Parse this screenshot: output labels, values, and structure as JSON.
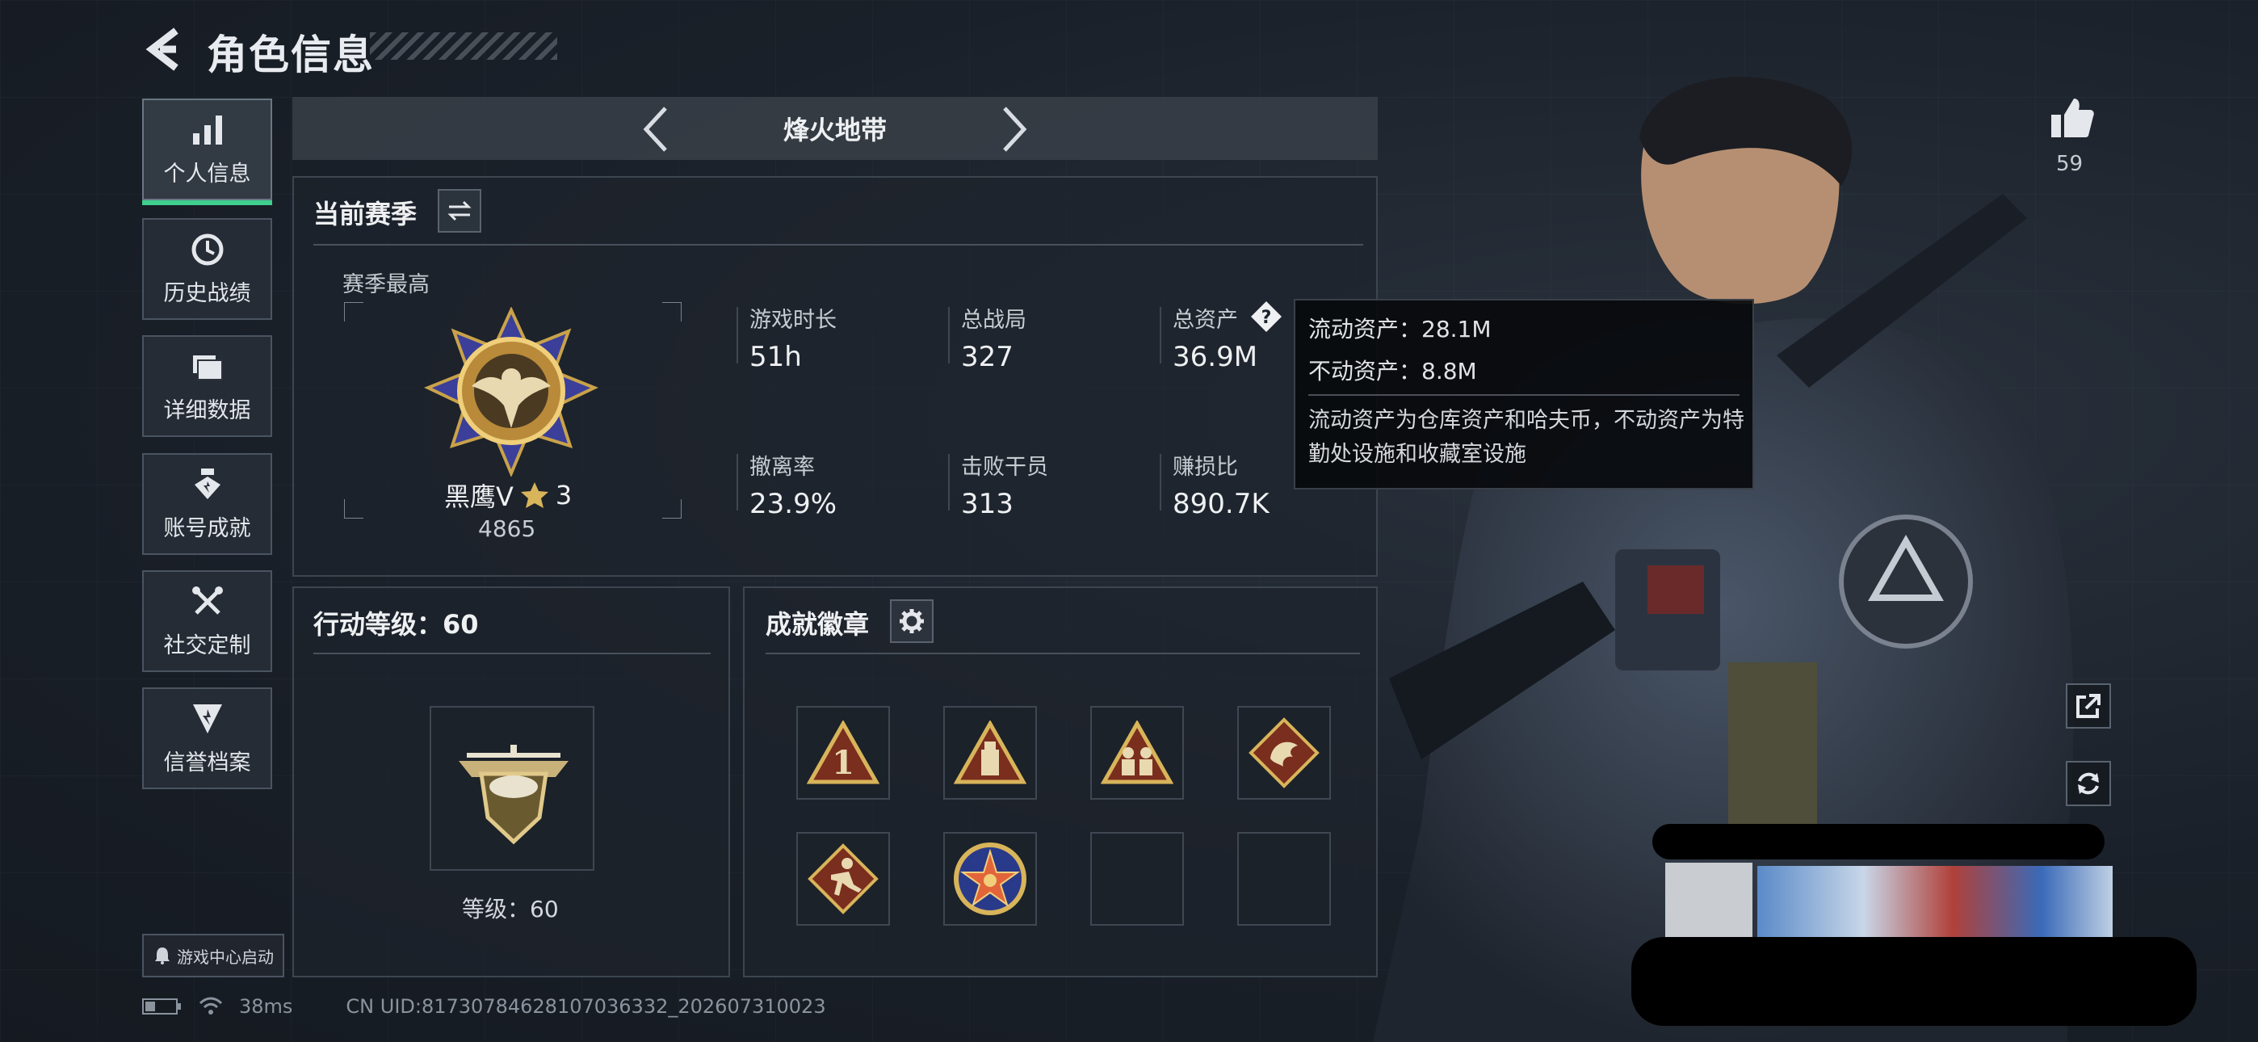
{
  "header": {
    "title": "角色信息"
  },
  "sidebar": {
    "items": [
      {
        "label": "个人信息",
        "icon": "bar-chart-icon",
        "active": true
      },
      {
        "label": "历史战绩",
        "icon": "history-clock-icon",
        "active": false
      },
      {
        "label": "详细数据",
        "icon": "folder-icon",
        "active": false
      },
      {
        "label": "账号成就",
        "icon": "medal-icon",
        "active": false
      },
      {
        "label": "社交定制",
        "icon": "tools-icon",
        "active": false
      },
      {
        "label": "信誉档案",
        "icon": "shield-icon",
        "active": false
      }
    ],
    "launch_label": "游戏中心启动"
  },
  "mode_nav": {
    "label": "烽火地带"
  },
  "season": {
    "title": "当前赛季",
    "best_label": "赛季最高",
    "rank_name": "黑鹰Ⅴ",
    "rank_stars": "3",
    "rank_points": "4865",
    "stats": [
      {
        "label": "游戏时长",
        "value": "51h"
      },
      {
        "label": "总战局",
        "value": "327"
      },
      {
        "label": "总资产",
        "value": "36.9M"
      },
      {
        "label": "撤离率",
        "value": "23.9%"
      },
      {
        "label": "击败干员",
        "value": "313"
      },
      {
        "label": "赚损比",
        "value": "890.7K"
      }
    ]
  },
  "tooltip": {
    "liquid": "流动资产：28.1M",
    "fixed": "不动资产：8.8M",
    "desc": "流动资产为仓库资产和哈夫币，不动资产为特勤处设施和收藏室设施"
  },
  "action_level": {
    "title": "行动等级：60",
    "level_label": "等级：60"
  },
  "badges": {
    "title": "成就徽章",
    "count_filled": 6,
    "count_total": 8
  },
  "likes": {
    "count": "59"
  },
  "status": {
    "ping": "38ms",
    "uid": "CN UID:8173078462810703633‌2_202607310023"
  }
}
